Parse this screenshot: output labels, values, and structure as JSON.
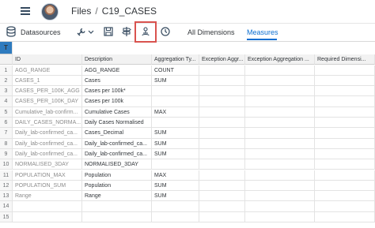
{
  "breadcrumb": {
    "root": "Files",
    "separator": "/",
    "current": "C19_CASES"
  },
  "toolbar": {
    "datasources_label": "Datasources",
    "tabs": [
      "All Dimensions",
      "Measures"
    ],
    "active_tab": "Measures"
  },
  "grid": {
    "corner_label": "T",
    "columns": [
      "ID",
      "Description",
      "Aggregation Ty...",
      "Exception Aggr...",
      "Exception Aggregation ...",
      "Required Dimensi..."
    ],
    "rows": [
      {
        "n": "1",
        "id": "AGG_RANGE",
        "desc": "AGG_RANGE",
        "agg": "COUNT"
      },
      {
        "n": "2",
        "id": "CASES_1",
        "desc": "Cases",
        "agg": "SUM"
      },
      {
        "n": "3",
        "id": "CASES_PER_100K_AGG",
        "desc": "Cases per 100k*",
        "agg": ""
      },
      {
        "n": "4",
        "id": "CASES_PER_100K_DAY",
        "desc": "Cases per 100k",
        "agg": ""
      },
      {
        "n": "5",
        "id": "Cumulative_lab-confirm...",
        "desc": "Cumulative Cases",
        "agg": "MAX"
      },
      {
        "n": "6",
        "id": "DAILY_CASES_NORMA...",
        "desc": "Daily Cases Normalised",
        "agg": ""
      },
      {
        "n": "7",
        "id": "Daily_lab-confirmed_ca...",
        "desc": "Cases_Decimal",
        "agg": "SUM"
      },
      {
        "n": "8",
        "id": "Daily_lab-confirmed_ca...",
        "desc": "Daily_lab-confirmed_ca...",
        "agg": "SUM"
      },
      {
        "n": "9",
        "id": "Daily_lab-confirmed_ca...",
        "desc": "Daily_lab-confirmed_ca...",
        "agg": "SUM"
      },
      {
        "n": "10",
        "id": "NORMALISED_3DAY",
        "desc": "NORMALISED_3DAY",
        "agg": ""
      },
      {
        "n": "11",
        "id": "POPULATION_MAX",
        "desc": "Population",
        "agg": "MAX"
      },
      {
        "n": "12",
        "id": "POPULATION_SUM",
        "desc": "Population",
        "agg": "SUM"
      },
      {
        "n": "13",
        "id": "Range",
        "desc": "Range",
        "agg": "SUM"
      },
      {
        "n": "14",
        "id": "",
        "desc": "",
        "agg": ""
      },
      {
        "n": "15",
        "id": "",
        "desc": "",
        "agg": ""
      }
    ]
  },
  "colors": {
    "accent": "#0a6ed1",
    "highlight_box": "#d9534f",
    "corner": "#2e7bbf"
  }
}
